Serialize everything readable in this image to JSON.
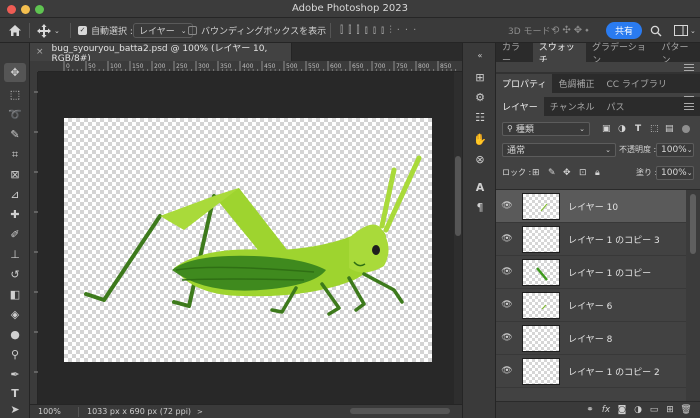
{
  "window": {
    "title": "Adobe Photoshop 2023"
  },
  "options_bar": {
    "auto_select_label": "自動選択 :",
    "auto_select_target": "レイヤー",
    "bounding_box_label": "バウンディングボックスを表示",
    "mode_3d_label": "3D モード :",
    "share_label": "共有"
  },
  "document": {
    "tab_title": "bug_syouryou_batta2.psd @ 100% (レイヤー 10, RGB/8#)",
    "zoom": "100%",
    "info": "1033 px x 690 px (72 ppi)"
  },
  "ruler": {
    "ticks": [
      "0",
      "50",
      "100",
      "150",
      "200",
      "250",
      "300",
      "350",
      "400",
      "450",
      "500",
      "550",
      "600",
      "650",
      "700",
      "750",
      "800",
      "850"
    ]
  },
  "panels": {
    "group1_tabs": [
      "カラー",
      "スウォッチ",
      "グラデーション",
      "パターン"
    ],
    "group1_active": 1,
    "group2_tabs": [
      "プロパティ",
      "色調補正",
      "CC ライブラリ"
    ],
    "group2_active": 0,
    "group3_tabs": [
      "レイヤー",
      "チャンネル",
      "パス"
    ],
    "group3_active": 0
  },
  "layers_panel": {
    "filter_kind": "種類",
    "blend_mode": "通常",
    "opacity_label": "不透明度 :",
    "opacity_value": "100%",
    "lock_label": "ロック :",
    "fill_label": "塗り :",
    "fill_value": "100%",
    "layers": [
      {
        "name": "レイヤー 10",
        "selected": true,
        "thumb": "stroke"
      },
      {
        "name": "レイヤー 1 のコピー 3",
        "selected": false,
        "thumb": "none"
      },
      {
        "name": "レイヤー 1 のコピー",
        "selected": false,
        "thumb": "leaf"
      },
      {
        "name": "レイヤー 6",
        "selected": false,
        "thumb": "stroke"
      },
      {
        "name": "レイヤー 8",
        "selected": false,
        "thumb": "none"
      },
      {
        "name": "レイヤー 1 のコピー 2",
        "selected": false,
        "thumb": "none"
      }
    ]
  },
  "colors": {
    "accent": "#2a7bf0",
    "grasshopper_light": "#9ed42f",
    "grasshopper_dark": "#3f8a1e",
    "leg": "#3d7a1c"
  }
}
